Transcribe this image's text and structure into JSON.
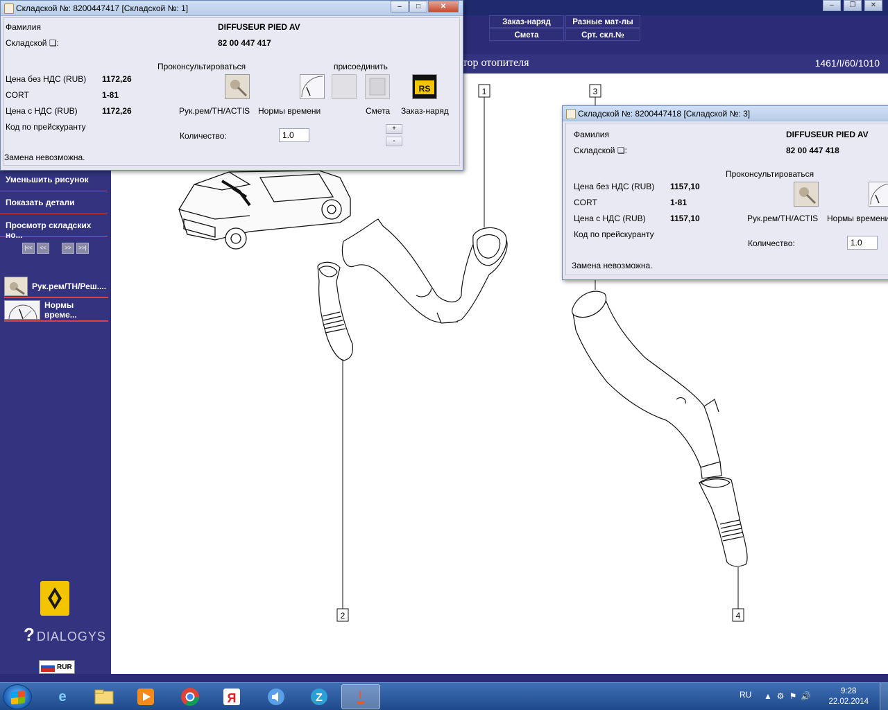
{
  "popup1": {
    "title": "Складской №: 8200447417 [Складской №: 1]",
    "family_label": "Фамилия",
    "family_value": "DIFFUSEUR PIED AV",
    "stock_label": "Складской ❏:",
    "stock_value": "82 00 447 417",
    "price_net_label": "Цена без НДС (RUB)",
    "price_net_value": "1172,26",
    "cort_label": "CORT",
    "cort_value": "1-81",
    "price_gross_label": "Цена с НДС (RUB)",
    "price_gross_value": "1172,26",
    "price_code_label": "Код по прейскуранту",
    "consult_label": "Проконсультироваться",
    "attach_label": "присоединить",
    "repair_label": "Рук.рем/TH/ACTIS",
    "time_label": "Нормы времени",
    "estimate_label": "Смета",
    "order_label": "Заказ-наряд",
    "qty_label": "Количество:",
    "qty_value": "1.0",
    "spin_up": "+",
    "spin_down": "-",
    "status": "Замена невозможна."
  },
  "popup2": {
    "title": "Складской №: 8200447418 [Складской №: 3]",
    "family_label": "Фамилия",
    "family_value": "DIFFUSEUR PIED AV",
    "stock_label": "Складской ❏:",
    "stock_value": "82 00 447 418",
    "price_net_label": "Цена без НДС (RUB)",
    "price_net_value": "1157,10",
    "cort_label": "CORT",
    "cort_value": "1-81",
    "price_gross_label": "Цена с НДС (RUB)",
    "price_gross_value": "1157,10",
    "price_code_label": "Код по прейскуранту",
    "consult_label": "Проконсультироваться",
    "repair_label": "Рук.рем/TH/ACTIS",
    "time_label": "Нормы времени",
    "qty_label": "Количество:",
    "qty_value": "1.0",
    "status": "Замена невозможна."
  },
  "menu": {
    "order": "Заказ-наряд",
    "misc": "Разные мат-лы",
    "estimate": "Смета",
    "stock_no": "Срт. скл.№"
  },
  "header": {
    "title_fragment": "атор отопителя",
    "reference": "1461/I/60/1010"
  },
  "sidebar": {
    "zoom_out": "Уменьшить рисунок",
    "show_details": "Показать детали",
    "view_stock": "Просмотр складских но...",
    "pager": [
      "|<<",
      "<<",
      ">>",
      ">>|"
    ],
    "tool_repair": "Рук.рем/TH/Реш....",
    "tool_time": "Нормы време...",
    "dialogys": "DIALOGYS",
    "currency": "RUR"
  },
  "diagram": {
    "callouts": [
      "1",
      "2",
      "3",
      "4"
    ]
  },
  "taskbar": {
    "lang": "RU",
    "time": "9:28",
    "date": "22.02.2014"
  },
  "colors": {
    "sidebar_bg": "#33337f",
    "accent_line": "#e04040",
    "popup_bg": "#e9e9f3"
  }
}
